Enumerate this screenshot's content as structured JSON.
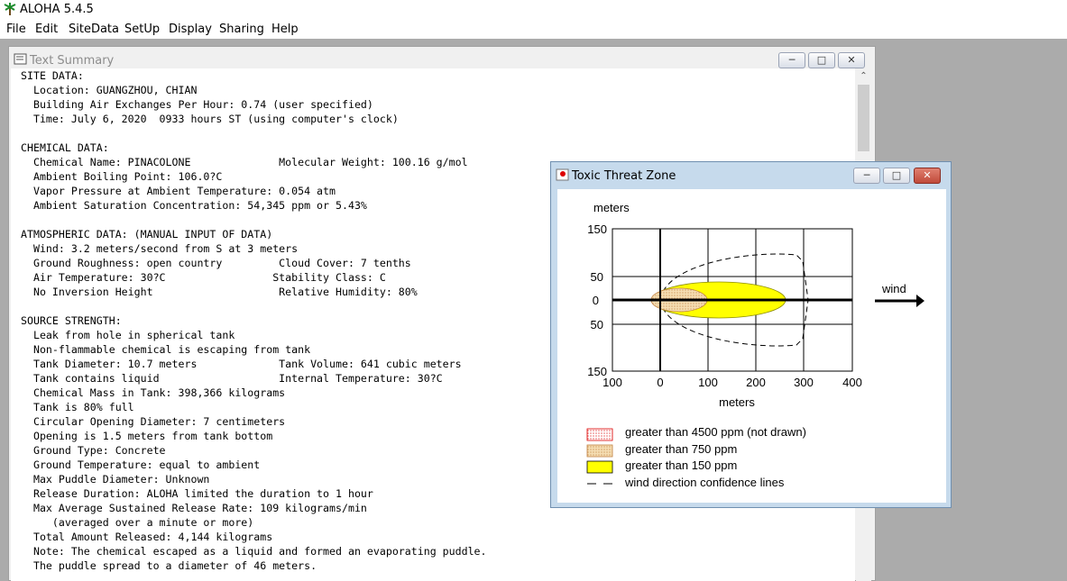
{
  "app": {
    "title": "ALOHA 5.4.5"
  },
  "menu": [
    "File",
    "Edit",
    "SiteData",
    "SetUp",
    "Display",
    "Sharing",
    "Help"
  ],
  "text_summary": {
    "title": "Text Summary",
    "lines": [
      "SITE DATA:",
      "  Location: GUANGZHOU, CHIAN",
      "  Building Air Exchanges Per Hour: 0.74 (user specified)",
      "  Time: July 6, 2020  0933 hours ST (using computer's clock)",
      "",
      "CHEMICAL DATA:",
      "  Chemical Name: PINACOLONE              Molecular Weight: 100.16 g/mol",
      "  Ambient Boiling Point: 106.0?C",
      "  Vapor Pressure at Ambient Temperature: 0.054 atm",
      "  Ambient Saturation Concentration: 54,345 ppm or 5.43%",
      "",
      "ATMOSPHERIC DATA: (MANUAL INPUT OF DATA)",
      "  Wind: 3.2 meters/second from S at 3 meters",
      "  Ground Roughness: open country         Cloud Cover: 7 tenths",
      "  Air Temperature: 30?C                 Stability Class: C",
      "  No Inversion Height                    Relative Humidity: 80%",
      "",
      "SOURCE STRENGTH:",
      "  Leak from hole in spherical tank",
      "  Non-flammable chemical is escaping from tank",
      "  Tank Diameter: 10.7 meters             Tank Volume: 641 cubic meters",
      "  Tank contains liquid                   Internal Temperature: 30?C",
      "  Chemical Mass in Tank: 398,366 kilograms",
      "  Tank is 80% full",
      "  Circular Opening Diameter: 7 centimeters",
      "  Opening is 1.5 meters from tank bottom",
      "  Ground Type: Concrete",
      "  Ground Temperature: equal to ambient",
      "  Max Puddle Diameter: Unknown",
      "  Release Duration: ALOHA limited the duration to 1 hour",
      "  Max Average Sustained Release Rate: 109 kilograms/min",
      "     (averaged over a minute or more)",
      "  Total Amount Released: 4,144 kilograms",
      "  Note: The chemical escaped as a liquid and formed an evaporating puddle.",
      "  The puddle spread to a diameter of 46 meters."
    ]
  },
  "toxic_window": {
    "title": "Toxic Threat Zone",
    "y_unit": "meters",
    "x_unit": "meters",
    "y_tick_labels": [
      "150",
      "50",
      "0",
      "50",
      "150"
    ],
    "x_tick_labels": [
      "100",
      "0",
      "100",
      "200",
      "300",
      "400"
    ],
    "wind_label": "wind",
    "legend": [
      {
        "label": "greater than 4500 ppm (not drawn)",
        "style": "red-dotted"
      },
      {
        "label": "greater than 750 ppm",
        "style": "orange-dotted"
      },
      {
        "label": "greater than 150 ppm",
        "style": "yellow-fill"
      },
      {
        "label": "wind direction confidence lines",
        "style": "dashed-line"
      }
    ],
    "colors": {
      "yellow_zone": "#ffff00",
      "orange_zone": "#f5deb3",
      "red_zone": "#ff0000"
    }
  }
}
